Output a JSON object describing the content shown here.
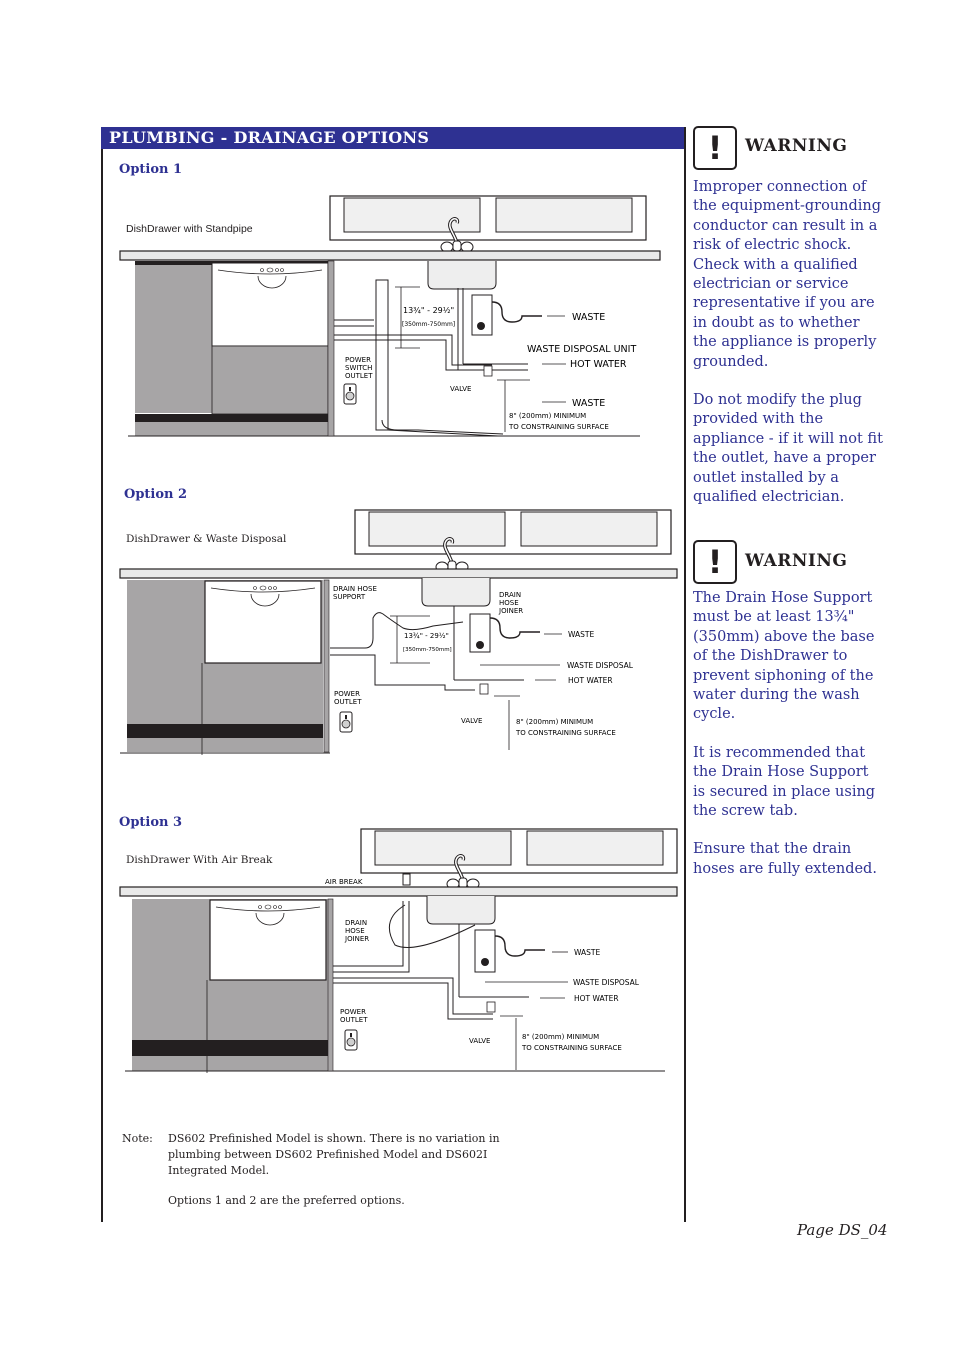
{
  "header": {
    "title": "PLUMBING  -  DRAINAGE OPTIONS"
  },
  "options": [
    {
      "label": "Option 1",
      "caption": "DishDrawer with Standpipe",
      "labels": {
        "dimension": "13¾\" - 29½\"",
        "dimension_mm": "[350mm-750mm]",
        "waste_top": "WASTE",
        "disposal": "WASTE DISPOSAL UNIT",
        "hot_water": "HOT WATER",
        "waste_bottom": "WASTE",
        "power": [
          "POWER",
          "SWITCH",
          "OUTLET"
        ],
        "valve": "VALVE",
        "minimum": "8\" (200mm) MINIMUM",
        "constraining": "TO CONSTRAINING  SURFACE"
      }
    },
    {
      "label": "Option 2",
      "caption": "DishDrawer & Waste Disposal",
      "labels": {
        "support": [
          "DRAIN HOSE",
          "SUPPORT"
        ],
        "joiner": [
          "DRAIN",
          "HOSE",
          "JOINER"
        ],
        "dimension": "13¾\" - 29½\"",
        "dimension_mm": "[350mm-750mm]",
        "waste": "WASTE",
        "disposal": "WASTE DISPOSAL",
        "hot_water": "HOT   WATER",
        "power": [
          "POWER",
          "OUTLET"
        ],
        "valve": "VALVE",
        "minimum": "8\" (200mm) MINIMUM",
        "constraining": "TO CONSTRAINING  SURFACE"
      }
    },
    {
      "label": "Option 3",
      "caption": "DishDrawer With Air Break",
      "labels": {
        "air_break": "AIR BREAK",
        "joiner": [
          "DRAIN",
          "HOSE",
          "JOINER"
        ],
        "waste": "WASTE",
        "disposal": "WASTE DISPOSAL",
        "hot_water": "HOT   WATER",
        "power": [
          "POWER",
          "OUTLET"
        ],
        "valve": "VALVE",
        "minimum": "8\" (200mm) MINIMUM",
        "constraining": "TO CONSTRAINING  SURFACE"
      }
    }
  ],
  "warnings": [
    {
      "title": "WARNING",
      "icon": "exclamation-icon",
      "paragraphs": [
        "Improper connection of the equipment-grounding conductor can result in a risk of electric shock. Check with a qualified electrician or service representative if you are in doubt as to whether the appliance is properly grounded.",
        "Do not modify the plug provided with the appliance - if it will not fit the outlet, have a proper outlet installed by a qualified electrician."
      ]
    },
    {
      "title": "WARNING",
      "icon": "exclamation-icon",
      "paragraphs": [
        "The Drain Hose Support must be at least 13¾\" (350mm) above the base of the DishDrawer to prevent siphoning of the water during the wash cycle.",
        "It is recommended that the Drain Hose Support is secured in place using the screw tab.",
        "Ensure that the drain hoses are fully extended."
      ]
    }
  ],
  "note": {
    "label": "Note:",
    "paragraphs": [
      "DS602 Prefinished Model is shown.  There is no variation in plumbing between DS602 Prefinished Model and DS602I Integrated Model.",
      "Options 1 and 2 are the preferred options."
    ]
  },
  "footer": {
    "page": "Page DS_04"
  },
  "colors": {
    "accent": "#2e3192",
    "cabinet_gray": "#a7a5a6",
    "ink": "#231f20"
  }
}
